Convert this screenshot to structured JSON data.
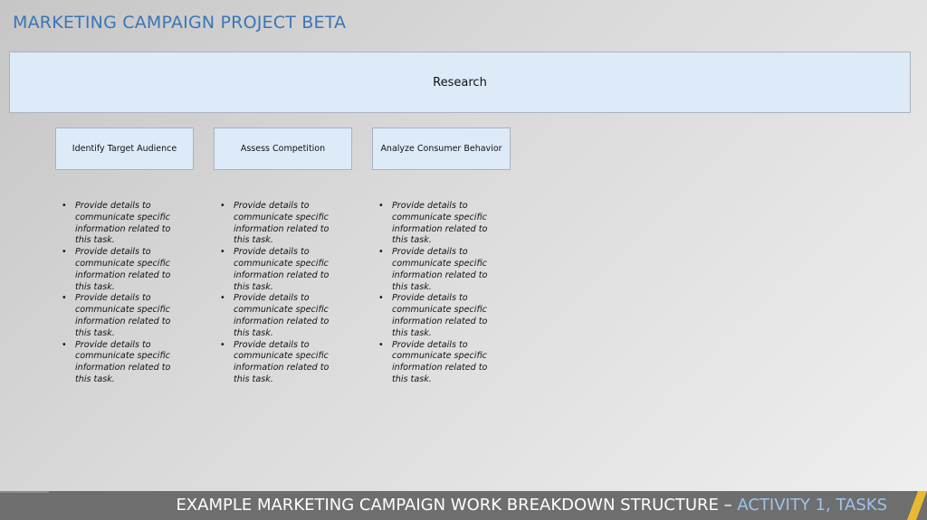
{
  "header": {
    "title": "MARKETING CAMPAIGN PROJECT BETA"
  },
  "wbs": {
    "root": "Research",
    "tasks": [
      {
        "label": "Identify Target Audience",
        "bullets": [
          "Provide details to communicate specific information related to this task.",
          "Provide details to communicate specific information related to this task.",
          "Provide details to communicate specific information related to this task.",
          "Provide details to communicate specific information related to this task."
        ]
      },
      {
        "label": "Assess Competition",
        "bullets": [
          "Provide details to communicate specific information related to this task.",
          "Provide details to communicate specific information related to this task.",
          "Provide details to communicate specific information related to this task.",
          "Provide details to communicate specific information related to this task."
        ]
      },
      {
        "label": "Analyze Consumer Behavior",
        "bullets": [
          "Provide details to communicate specific information related to this task.",
          "Provide details to communicate specific information related to this task.",
          "Provide details to communicate specific information related to this task.",
          "Provide details to communicate specific information related to this task."
        ]
      }
    ]
  },
  "footer": {
    "text": "EXAMPLE MARKETING CAMPAIGN WORK BREAKDOWN STRUCTURE – ",
    "accent": "ACTIVITY 1, TASKS"
  },
  "colors": {
    "title": "#3a76b5",
    "box_fill": "#ddeaf8",
    "footer_bg": "#6e6e6e",
    "footer_accent": "#9cc3ec",
    "slash": "#e8b931"
  }
}
